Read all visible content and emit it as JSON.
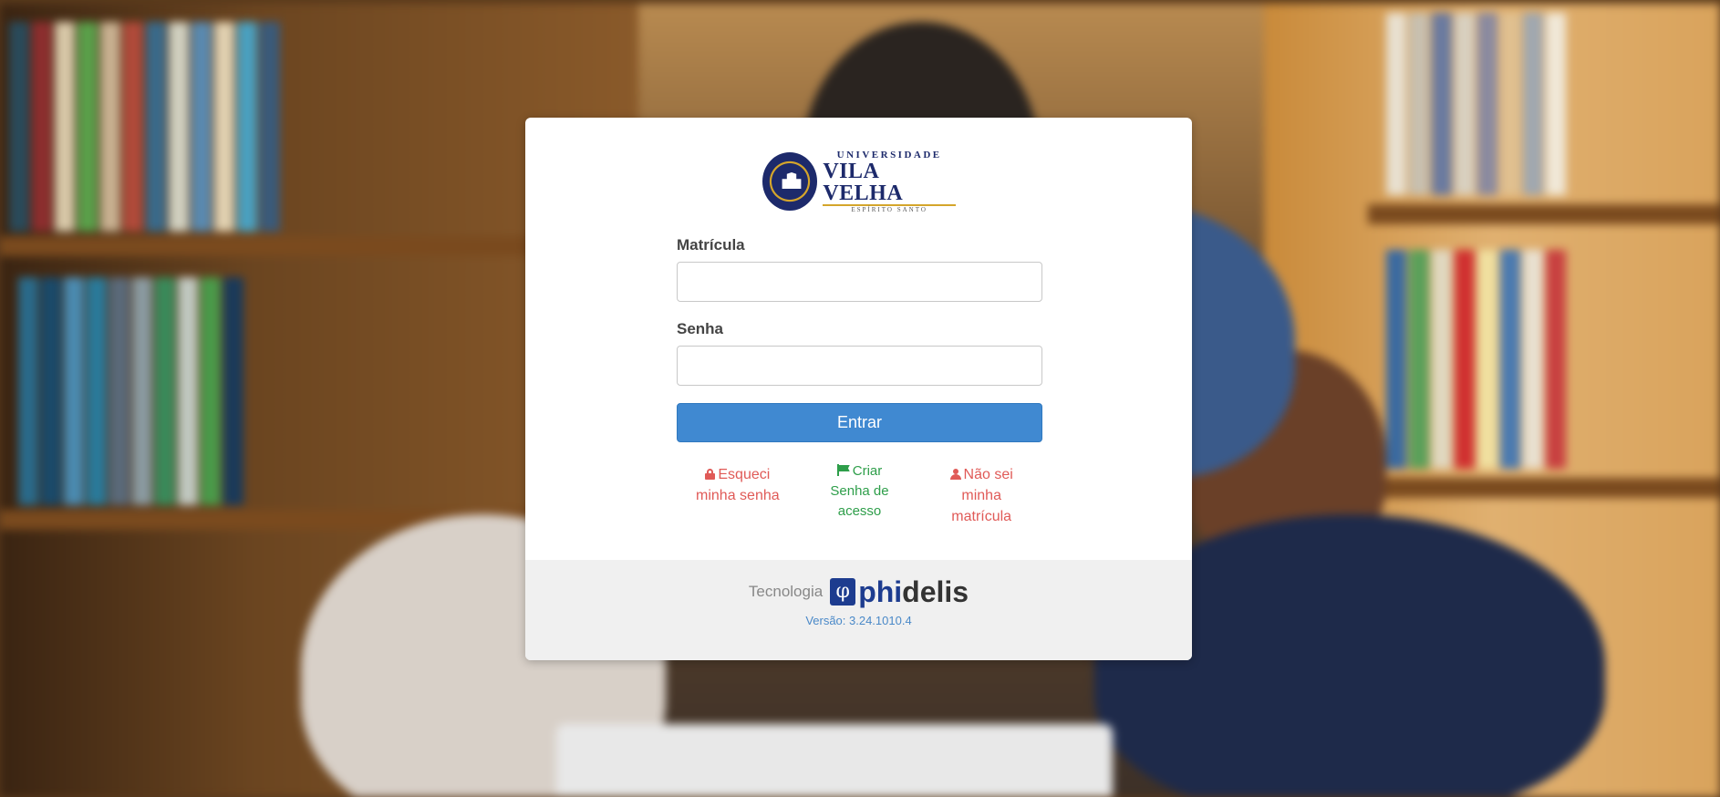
{
  "background": {
    "description_icon": "library-background"
  },
  "logo": {
    "icon": "university-seal-icon",
    "line1": "UNIVERSIDADE",
    "line2": "VILA VELHA",
    "line3": "ESPÍRITO SANTO"
  },
  "form": {
    "matricula_label": "Matrícula",
    "matricula_value": "",
    "senha_label": "Senha",
    "senha_value": "",
    "submit_label": "Entrar"
  },
  "links": {
    "forgot_password": {
      "icon": "lock-icon",
      "line1": "Esqueci",
      "line2": "minha senha"
    },
    "create_password": {
      "icon": "flag-icon",
      "line1": "Criar",
      "line2": "Senha de",
      "line3": "acesso"
    },
    "unknown_matricula": {
      "icon": "user-icon",
      "line1": "Não sei",
      "line2": "minha",
      "line3": "matrícula"
    }
  },
  "footer": {
    "tech_label": "Tecnologia",
    "brand_phi": "φ",
    "brand_part1": "phi",
    "brand_part2": "delis",
    "version": "Versão: 3.24.1010.4"
  },
  "colors": {
    "primary_button": "#4089d1",
    "link_red": "#e05a57",
    "link_green": "#2e9e4a",
    "version_blue": "#4a89c8",
    "footer_bg": "#f0f0f0"
  }
}
